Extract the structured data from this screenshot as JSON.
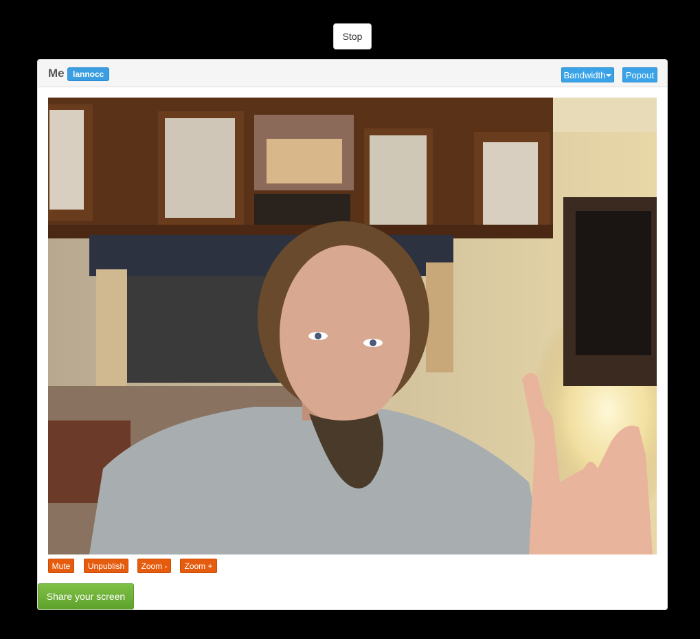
{
  "top": {
    "stop_label": "Stop"
  },
  "panel": {
    "title": "Me",
    "username": "lannocc",
    "bandwidth_label": "Bandwidth",
    "popout_label": "Popout"
  },
  "video": {
    "description_icon": "webcam-feed"
  },
  "controls": {
    "mute_label": "Mute",
    "unpublish_label": "Unpublish",
    "zoom_out_label": "Zoom -",
    "zoom_in_label": "Zoom +"
  },
  "share": {
    "label": "Share your screen"
  },
  "colors": {
    "primary_blue": "#3aa3e8",
    "orange": "#e65c0e",
    "green": "#6cb036"
  }
}
